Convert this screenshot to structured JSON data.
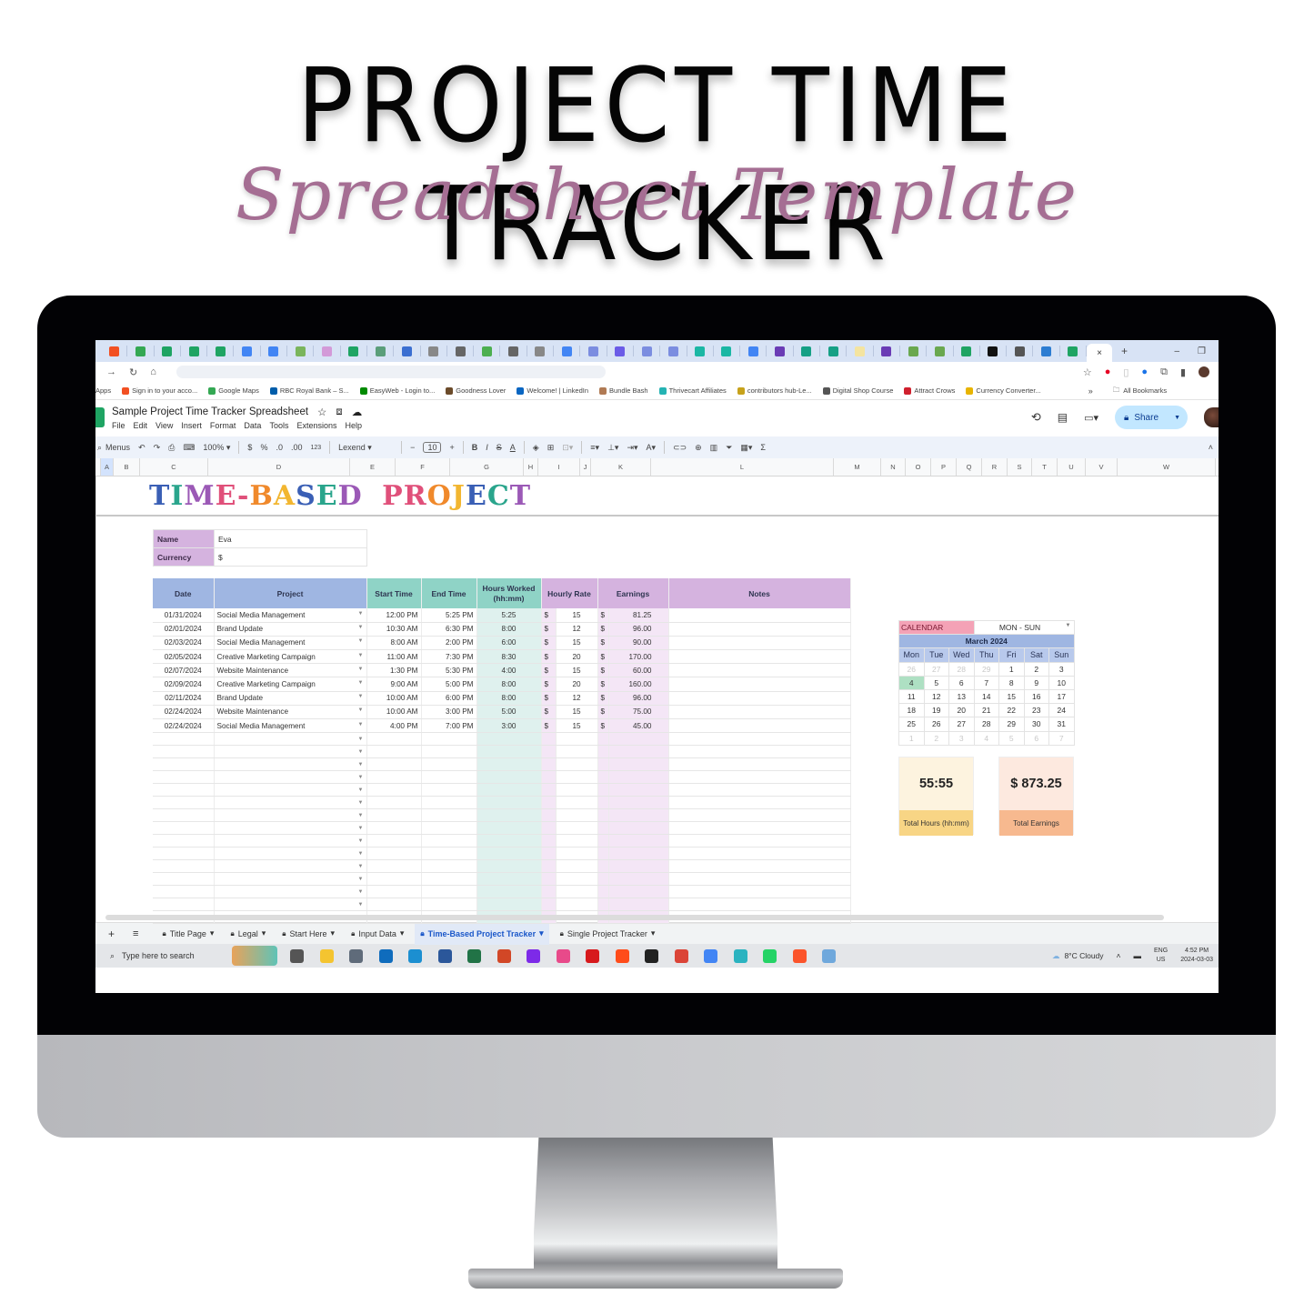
{
  "hero": {
    "title": "PROJECT TIME TRACKER",
    "subtitle": "Spreadsheet Template"
  },
  "browser": {
    "tab_close": "×",
    "new_tab": "+",
    "minimize": "–",
    "restore": "❐",
    "bookmarks": [
      {
        "label": "Apps",
        "icon": "apps-icon",
        "color": "#ffffff"
      },
      {
        "label": "Sign in to your acco...",
        "icon": "microsoft-icon",
        "color": "#f25022"
      },
      {
        "label": "Google Maps",
        "icon": "map-pin-icon",
        "color": "#34a853"
      },
      {
        "label": "RBC Royal Bank – S...",
        "icon": "rbc-icon",
        "color": "#005daa"
      },
      {
        "label": "EasyWeb - Login to...",
        "icon": "td-icon",
        "color": "#008a00"
      },
      {
        "label": "Goodness Lover",
        "icon": "leaf-icon",
        "color": "#6b4b2a"
      },
      {
        "label": "Welcome! | LinkedIn",
        "icon": "linkedin-icon",
        "color": "#0a66c2"
      },
      {
        "label": "Bundle Bash",
        "icon": "arch-icon",
        "color": "#b07a54"
      },
      {
        "label": "Thrivecart Affiliates",
        "icon": "thrivecart-icon",
        "color": "#24b3b3"
      },
      {
        "label": "contributors hub-Le...",
        "icon": "z-icon",
        "color": "#c7a21b"
      },
      {
        "label": "Digital Shop Course",
        "icon": "globe-icon",
        "color": "#555555"
      },
      {
        "label": "Attract Crows",
        "icon": "hq-icon",
        "color": "#d0202e"
      },
      {
        "label": "Currency Converter...",
        "icon": "currency-icon",
        "color": "#e8b400"
      }
    ],
    "more_bookmarks": "»",
    "all_bookmarks": "All Bookmarks"
  },
  "doc": {
    "title": "Sample Project Time Tracker Spreadsheet",
    "menu": [
      "File",
      "Edit",
      "View",
      "Insert",
      "Format",
      "Data",
      "Tools",
      "Extensions",
      "Help"
    ],
    "share_label": "Share"
  },
  "toolbar": {
    "search_menus": "Menus",
    "zoom": "100%",
    "currency": "$",
    "percent": "%",
    "dec_decrease": ".0",
    "dec_increase": ".00",
    "number_format": "123",
    "font": "Lexend",
    "font_size": "10",
    "bold": "B",
    "italic": "I",
    "strike": "S",
    "text_color": "A",
    "sum": "Σ"
  },
  "columns": [
    "A",
    "B",
    "C",
    "D",
    "E",
    "F",
    "G",
    "H",
    "I",
    "J",
    "K",
    "L",
    "M",
    "N",
    "O",
    "P",
    "Q",
    "R",
    "S",
    "T",
    "U",
    "V",
    "W"
  ],
  "sheet": {
    "title_letters": [
      {
        "ch": "T",
        "color": "#3a5fb5"
      },
      {
        "ch": "I",
        "color": "#2aa58c"
      },
      {
        "ch": "M",
        "color": "#9b59b6"
      },
      {
        "ch": "E",
        "color": "#e0507a"
      },
      {
        "ch": "-",
        "color": "#e0507a"
      },
      {
        "ch": "B",
        "color": "#f0892b"
      },
      {
        "ch": "A",
        "color": "#f2b630"
      },
      {
        "ch": "S",
        "color": "#3a5fb5"
      },
      {
        "ch": "E",
        "color": "#2aa58c"
      },
      {
        "ch": "D",
        "color": "#9b59b6"
      },
      {
        "ch": " ",
        "color": "#000000"
      },
      {
        "ch": "P",
        "color": "#e0507a"
      },
      {
        "ch": "R",
        "color": "#e0507a"
      },
      {
        "ch": "O",
        "color": "#f0892b"
      },
      {
        "ch": "J",
        "color": "#f2b630"
      },
      {
        "ch": "E",
        "color": "#3a5fb5"
      },
      {
        "ch": "C",
        "color": "#2aa58c"
      },
      {
        "ch": "T",
        "color": "#9b59b6"
      }
    ],
    "name_label": "Name",
    "name_value": "Eva",
    "currency_label": "Currency",
    "currency_value": "$",
    "headers": {
      "date": "Date",
      "project": "Project",
      "start": "Start Time",
      "end": "End Time",
      "hours": "Hours Worked (hh:mm)",
      "rate": "Hourly Rate",
      "earnings": "Earnings",
      "notes": "Notes"
    },
    "rows": [
      {
        "date": "01/31/2024",
        "project": "Social Media Management",
        "start": "12:00 PM",
        "end": "5:25 PM",
        "hours": "5:25",
        "cur": "$",
        "rate": "15",
        "earnings": "81.25"
      },
      {
        "date": "02/01/2024",
        "project": "Brand Update",
        "start": "10:30 AM",
        "end": "6:30 PM",
        "hours": "8:00",
        "cur": "$",
        "rate": "12",
        "earnings": "96.00"
      },
      {
        "date": "02/03/2024",
        "project": "Social Media Management",
        "start": "8:00 AM",
        "end": "2:00 PM",
        "hours": "6:00",
        "cur": "$",
        "rate": "15",
        "earnings": "90.00"
      },
      {
        "date": "02/05/2024",
        "project": "Creative Marketing Campaign",
        "start": "11:00 AM",
        "end": "7:30 PM",
        "hours": "8:30",
        "cur": "$",
        "rate": "20",
        "earnings": "170.00"
      },
      {
        "date": "02/07/2024",
        "project": "Website Maintenance",
        "start": "1:30 PM",
        "end": "5:30 PM",
        "hours": "4:00",
        "cur": "$",
        "rate": "15",
        "earnings": "60.00"
      },
      {
        "date": "02/09/2024",
        "project": "Creative Marketing Campaign",
        "start": "9:00 AM",
        "end": "5:00 PM",
        "hours": "8:00",
        "cur": "$",
        "rate": "20",
        "earnings": "160.00"
      },
      {
        "date": "02/11/2024",
        "project": "Brand Update",
        "start": "10:00 AM",
        "end": "6:00 PM",
        "hours": "8:00",
        "cur": "$",
        "rate": "12",
        "earnings": "96.00"
      },
      {
        "date": "02/24/2024",
        "project": "Website Maintenance",
        "start": "10:00 AM",
        "end": "3:00 PM",
        "hours": "5:00",
        "cur": "$",
        "rate": "15",
        "earnings": "75.00"
      },
      {
        "date": "02/24/2024",
        "project": "Social Media Management",
        "start": "4:00 PM",
        "end": "7:00 PM",
        "hours": "3:00",
        "cur": "$",
        "rate": "15",
        "earnings": "45.00"
      }
    ],
    "empty_rows": 15,
    "earnings_currency": "$"
  },
  "calendar": {
    "label": "CALENDAR",
    "week_mode": "MON - SUN",
    "month": "March 2024",
    "days": [
      "Mon",
      "Tue",
      "Wed",
      "Thu",
      "Fri",
      "Sat",
      "Sun"
    ],
    "weeks": [
      [
        {
          "d": "26",
          "dim": true
        },
        {
          "d": "27",
          "dim": true
        },
        {
          "d": "28",
          "dim": true
        },
        {
          "d": "29",
          "dim": true
        },
        {
          "d": "1"
        },
        {
          "d": "2"
        },
        {
          "d": "3"
        }
      ],
      [
        {
          "d": "4",
          "today": true
        },
        {
          "d": "5"
        },
        {
          "d": "6"
        },
        {
          "d": "7"
        },
        {
          "d": "8"
        },
        {
          "d": "9"
        },
        {
          "d": "10"
        }
      ],
      [
        {
          "d": "11"
        },
        {
          "d": "12"
        },
        {
          "d": "13"
        },
        {
          "d": "14"
        },
        {
          "d": "15"
        },
        {
          "d": "16"
        },
        {
          "d": "17"
        }
      ],
      [
        {
          "d": "18"
        },
        {
          "d": "19"
        },
        {
          "d": "20"
        },
        {
          "d": "21"
        },
        {
          "d": "22"
        },
        {
          "d": "23"
        },
        {
          "d": "24"
        }
      ],
      [
        {
          "d": "25"
        },
        {
          "d": "26"
        },
        {
          "d": "27"
        },
        {
          "d": "28"
        },
        {
          "d": "29"
        },
        {
          "d": "30"
        },
        {
          "d": "31"
        }
      ],
      [
        {
          "d": "1",
          "dim": true
        },
        {
          "d": "2",
          "dim": true
        },
        {
          "d": "3",
          "dim": true
        },
        {
          "d": "4",
          "dim": true
        },
        {
          "d": "5",
          "dim": true
        },
        {
          "d": "6",
          "dim": true
        },
        {
          "d": "7",
          "dim": true
        }
      ]
    ]
  },
  "summary": {
    "total_hours": "55:55",
    "total_hours_label": "Total Hours (hh:mm)",
    "total_earnings": "$ 873.25",
    "total_earnings_label": "Total Earnings",
    "hours_colors": {
      "value_bg": "#fdf3df",
      "label_bg": "#f8d585"
    },
    "earnings_colors": {
      "value_bg": "#fde9df",
      "label_bg": "#f7b98f"
    }
  },
  "sheet_tabs": [
    {
      "label": "Title Page",
      "active": false
    },
    {
      "label": "Legal",
      "active": false
    },
    {
      "label": "Start Here",
      "active": false
    },
    {
      "label": "Input Data",
      "active": false
    },
    {
      "label": "Time-Based Project Tracker",
      "active": true
    },
    {
      "label": "Single Project Tracker",
      "active": false
    }
  ],
  "taskbar": {
    "search_placeholder": "Type here to search",
    "weather": "8°C  Cloudy",
    "lang_top": "ENG",
    "lang_bottom": "US",
    "time": "4:52 PM",
    "date": "2024-03-03",
    "apps": [
      {
        "name": "task-view-icon",
        "color": "#555"
      },
      {
        "name": "file-explorer-icon",
        "color": "#f4c430"
      },
      {
        "name": "calculator-icon",
        "color": "#5f6b7a"
      },
      {
        "name": "outlook-icon",
        "color": "#0f6cbd"
      },
      {
        "name": "copilot-icon",
        "color": "#1c8fd1"
      },
      {
        "name": "word-icon",
        "color": "#2b579a"
      },
      {
        "name": "excel-icon",
        "color": "#217346"
      },
      {
        "name": "powerpoint-icon",
        "color": "#d24726"
      },
      {
        "name": "canva-icon",
        "color": "#7d2ae8"
      },
      {
        "name": "edge-dev-icon",
        "color": "#e84a8a"
      },
      {
        "name": "acrobat-icon",
        "color": "#d7191c"
      },
      {
        "name": "ea-icon",
        "color": "#ff4c1a"
      },
      {
        "name": "notion-icon",
        "color": "#222"
      },
      {
        "name": "chrome-profile-icon",
        "color": "#db4437"
      },
      {
        "name": "chrome-icon",
        "color": "#4285f4"
      },
      {
        "name": "vectornator-icon",
        "color": "#2bb3c0"
      },
      {
        "name": "whatsapp-icon",
        "color": "#25d366"
      },
      {
        "name": "brave-icon",
        "color": "#fb542b"
      },
      {
        "name": "notepad-icon",
        "color": "#6fa8dc"
      }
    ]
  },
  "browser_tabs": [
    "#f25022",
    "#34a853",
    "#1fa463",
    "#1fa463",
    "#1fa463",
    "#4285f4",
    "#4285f4",
    "#7ab55c",
    "#d39ad8",
    "#1fa463",
    "#5a9e7a",
    "#3b6fd1",
    "#888888",
    "#666666",
    "#4caf50",
    "#666666",
    "#888888",
    "#4285f4",
    "#7b8de0",
    "#6b5ce7",
    "#7b8de0",
    "#7b8de0",
    "#1bb7a4",
    "#1bb7a4",
    "#4285f4",
    "#6a3cb5",
    "#16a085",
    "#16a085",
    "#f4e4a0",
    "#6a3cb5",
    "#6aa84f",
    "#6aa84f",
    "#1fa463",
    "#111111",
    "#555555",
    "#2d7dd2",
    "#1fa463"
  ]
}
